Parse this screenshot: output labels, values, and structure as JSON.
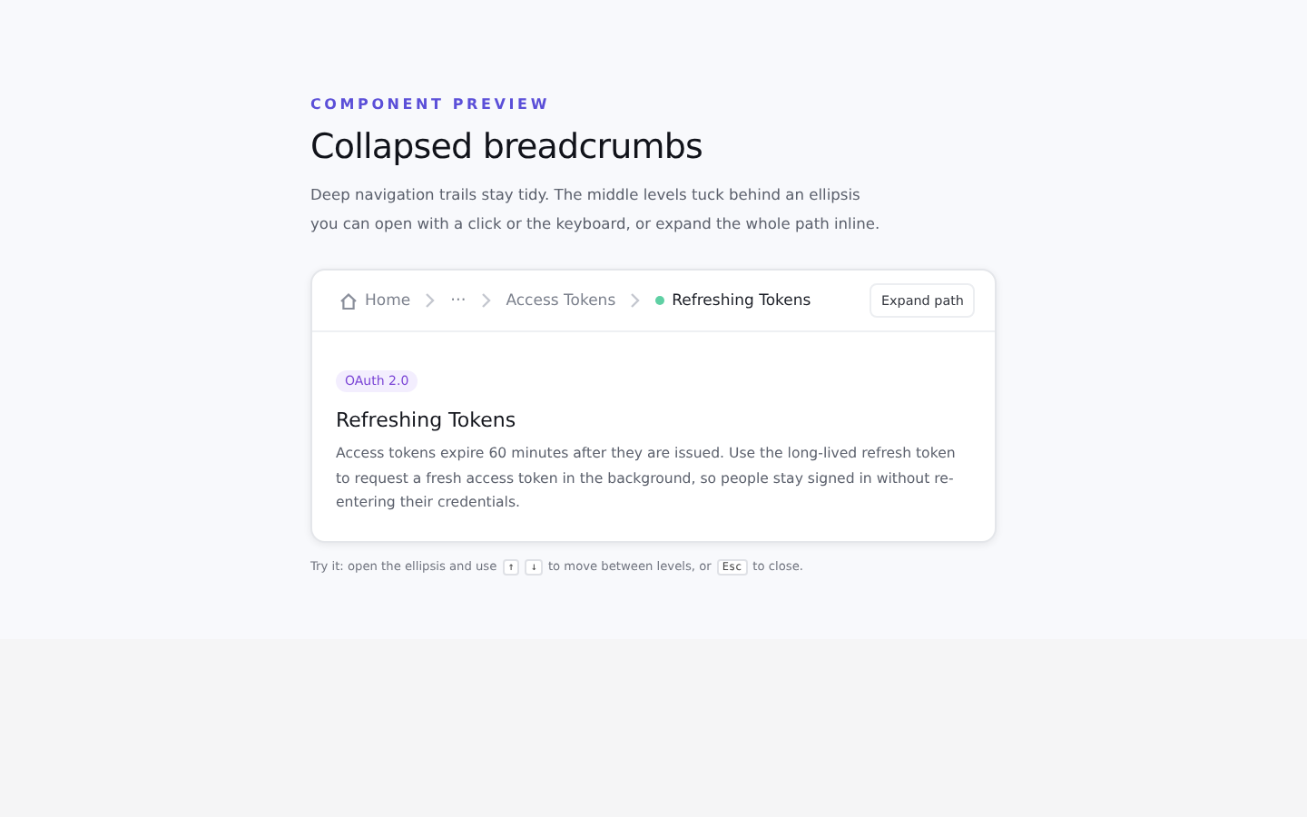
{
  "eyebrow": "COMPONENT PREVIEW",
  "title": "Collapsed breadcrumbs",
  "description": "Deep navigation trails stay tidy. The middle levels tuck behind an ellipsis you can open with a click or the keyboard, or expand the whole path inline.",
  "breadcrumbs": [
    {
      "kind": "home",
      "label": "Home"
    },
    {
      "kind": "ellipsis",
      "label": "···"
    },
    {
      "kind": "link",
      "label": "Access Tokens"
    },
    {
      "kind": "current",
      "label": "Refreshing Tokens",
      "color": "#5fd0a4"
    }
  ],
  "expand_button": "Expand path",
  "card": {
    "badge": "OAuth 2.0",
    "heading": "Refreshing Tokens",
    "body": "Access tokens expire 60 minutes after they are issued. Use the long-lived refresh token to request a fresh access token in the background, so people stay signed in without re-entering their credentials."
  },
  "hint": [
    {
      "kind": "text",
      "text": "Try it: open the ellipsis and use"
    },
    {
      "kind": "key",
      "text": "↑"
    },
    {
      "kind": "key",
      "text": "↓"
    },
    {
      "kind": "text",
      "text": "to move between levels, or"
    },
    {
      "kind": "key",
      "text": "Esc"
    },
    {
      "kind": "text",
      "text": "to close."
    }
  ]
}
